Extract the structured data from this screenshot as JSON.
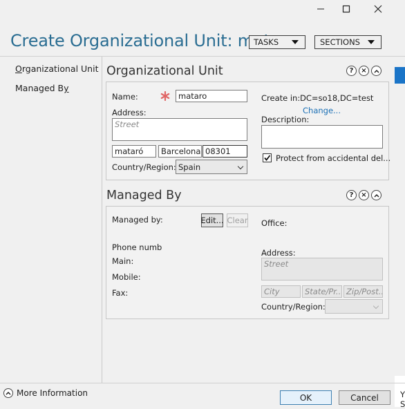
{
  "window": {
    "minimize_icon": "minimize-icon",
    "maximize_icon": "maximize-icon",
    "close_icon": "close-icon"
  },
  "header": {
    "title": "Create Organizational Unit: mata...",
    "tasks_label": "TASKS",
    "sections_label": "SECTIONS"
  },
  "nav": {
    "items": [
      {
        "label": "Organizational Unit",
        "mnemonic": "O"
      },
      {
        "label": "Managed By",
        "mnemonic": "y"
      }
    ]
  },
  "ou": {
    "section_title": "Organizational Unit",
    "name_label": "Name:",
    "name_value": "mataro",
    "address_label": "Address:",
    "street_placeholder": "Street",
    "city_value": "mataró",
    "state_value": "Barcelona",
    "zip_value": "08301",
    "country_label": "Country/Region:",
    "country_value": "Spain",
    "create_in_label": "Create in:",
    "create_in_value": "DC=so18,DC=test",
    "change_link": "Change...",
    "description_label": "Description:",
    "description_value": "",
    "protect_label": "Protect from accidental del...",
    "protect_checked": true
  },
  "managed": {
    "section_title": "Managed By",
    "managed_by_label": "Managed by:",
    "edit_label": "Edit...",
    "clear_label": "Clear",
    "office_label": "Office:",
    "phone_label": "Phone numb",
    "main_label": "Main:",
    "mobile_label": "Mobile:",
    "fax_label": "Fax:",
    "address_label": "Address:",
    "street_placeholder": "Street",
    "city_placeholder": "City",
    "state_placeholder": "State/Pr...",
    "zip_placeholder": "Zip/Post...",
    "country_label": "Country/Region:"
  },
  "footer": {
    "more_info": "More Information",
    "ok_label": "OK",
    "cancel_label": "Cancel",
    "edge_text_1": "Y",
    "edge_text_2": "S"
  },
  "colors": {
    "accent": "#2a6d92",
    "link": "#1a6fb5",
    "required": "#e06666",
    "selection": "#1a74c7"
  }
}
